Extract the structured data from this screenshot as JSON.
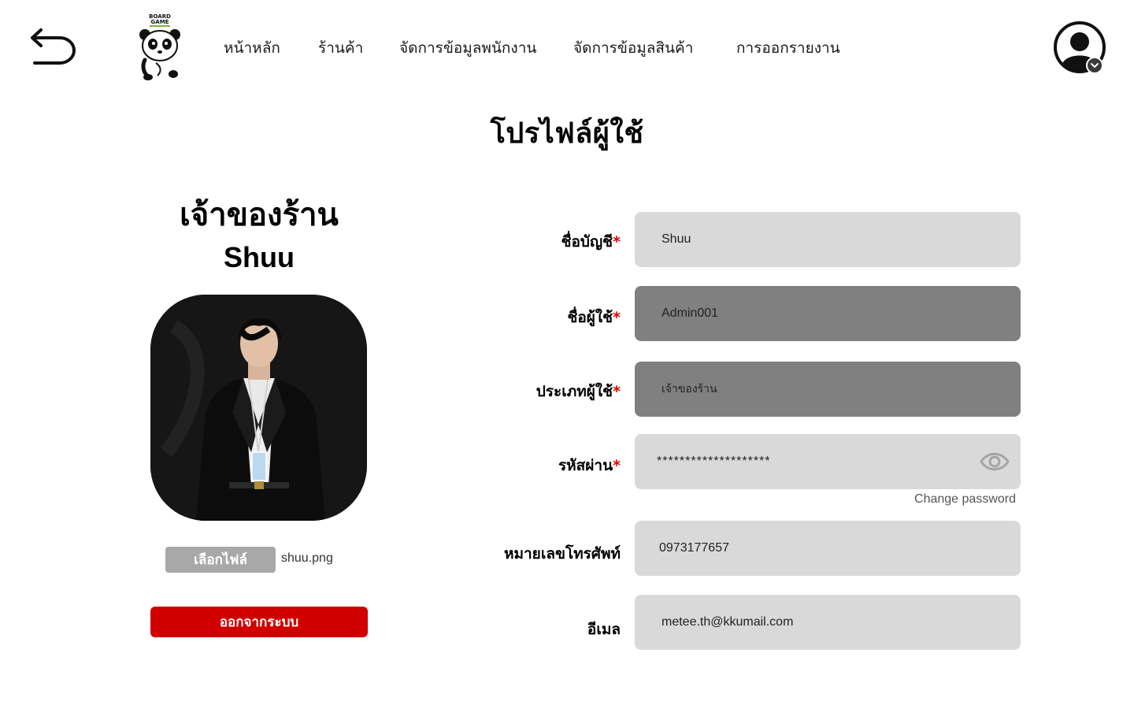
{
  "header": {
    "back_icon": "back-arrow-icon",
    "logo": {
      "line1": "BOARD",
      "line2": "GAME"
    },
    "nav": [
      "หน้าหลัก",
      "ร้านค้า",
      "จัดการข้อมูลพนักงาน",
      "จัดการข้อมูลสินค้า",
      "การออกรายงาน"
    ],
    "avatar_icon": "user-avatar-icon"
  },
  "page_title": "โปรไฟล์ผู้ใช้",
  "profile": {
    "role": "เจ้าของร้าน",
    "name": "Shuu",
    "choose_file_label": "เลือกไฟล์",
    "file_name": "shuu.png",
    "logout_label": "ออกจากระบบ"
  },
  "form": {
    "account_name": {
      "label": "ชื่อบัญชี",
      "required": "*",
      "value": "Shuu"
    },
    "username": {
      "label": "ชื่อผู้ใช้",
      "required": "*",
      "value": "Admin001"
    },
    "user_type": {
      "label": "ประเภทผู้ใช้",
      "required": "*",
      "value": "เจ้าของร้าน"
    },
    "password": {
      "label": "รหัสผ่าน",
      "required": "*",
      "value": "********************",
      "change_label": "Change password"
    },
    "phone": {
      "label": "หมายเลขโทรศัพท์",
      "value": "0973177657"
    },
    "email": {
      "label": "อีเมล",
      "value": "metee.th@kkumail.com"
    }
  },
  "colors": {
    "logout": "#d10000",
    "field_light": "#d9d9d9",
    "field_dark": "#808080",
    "required": "#e00000"
  }
}
